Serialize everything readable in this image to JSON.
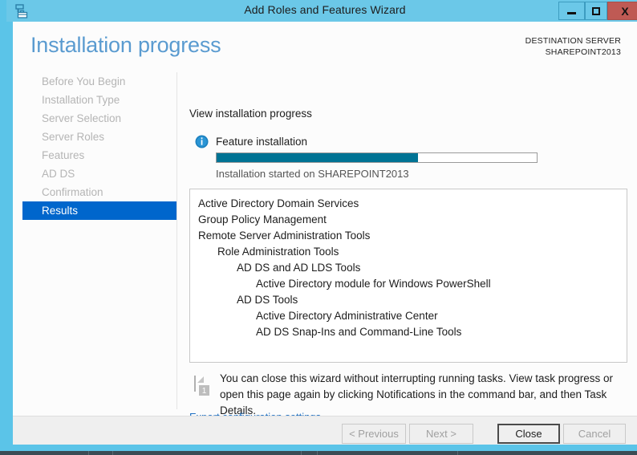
{
  "window": {
    "title": "Add Roles and Features Wizard",
    "icon": "server-wizard-icon",
    "minimize_label": "minimize",
    "maximize_label": "maximize",
    "close_label": "X",
    "titlebar_color": "#6bc8e8",
    "close_button_color": "#bf5a54"
  },
  "header": {
    "page_title": "Installation progress",
    "destination_label": "DESTINATION SERVER",
    "destination_server": "SHAREPOINT2013",
    "title_color": "#5a9bd0"
  },
  "sidebar": {
    "items": [
      {
        "label": "Before You Begin",
        "active": false
      },
      {
        "label": "Installation Type",
        "active": false
      },
      {
        "label": "Server Selection",
        "active": false
      },
      {
        "label": "Server Roles",
        "active": false
      },
      {
        "label": "Features",
        "active": false
      },
      {
        "label": "AD DS",
        "active": false
      },
      {
        "label": "Confirmation",
        "active": false
      },
      {
        "label": "Results",
        "active": true
      }
    ],
    "active_color": "#0066cc",
    "inactive_color": "#b5b5b5"
  },
  "main": {
    "view_label": "View installation progress",
    "info_icon": "info-icon",
    "feature_installation_label": "Feature installation",
    "progress": {
      "percent": 63,
      "fill_color": "#007394",
      "status_text": "Installation started on SHAREPOINT2013"
    },
    "results": [
      {
        "text": "Active Directory Domain Services",
        "indent": 0
      },
      {
        "text": "Group Policy Management",
        "indent": 0
      },
      {
        "text": "Remote Server Administration Tools",
        "indent": 0
      },
      {
        "text": "Role Administration Tools",
        "indent": 1
      },
      {
        "text": "AD DS and AD LDS Tools",
        "indent": 2
      },
      {
        "text": "Active Directory module for Windows PowerShell",
        "indent": 3
      },
      {
        "text": "AD DS Tools",
        "indent": 2
      },
      {
        "text": "Active Directory Administrative Center",
        "indent": 3
      },
      {
        "text": "AD DS Snap-Ins and Command-Line Tools",
        "indent": 3
      }
    ],
    "note": {
      "icon": "notification-flag-icon",
      "badge": "1",
      "text": "You can close this wizard without interrupting running tasks. View task progress or open this page again by clicking Notifications in the command bar, and then Task Details."
    },
    "export_link": "Export configuration settings"
  },
  "footer": {
    "buttons": [
      {
        "label": "< Previous",
        "state": "disabled"
      },
      {
        "label": "Next >",
        "state": "disabled"
      },
      {
        "label": "Close",
        "state": "default"
      },
      {
        "label": "Cancel",
        "state": "disabled"
      }
    ]
  }
}
